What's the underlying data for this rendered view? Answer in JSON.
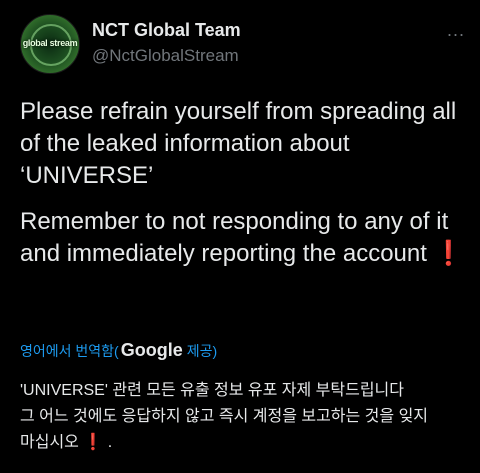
{
  "header": {
    "avatar_text": "global stream",
    "name": "NCT Global Team",
    "handle": "@NctGlobalStream",
    "more_icon": "..."
  },
  "tweet": {
    "paragraph1": "Please refrain yourself from spreading all of the leaked information about ‘UNIVERSE’",
    "paragraph2": "Remember to not responding to any of it and immediately reporting the account",
    "exclamation": "❗"
  },
  "translation": {
    "label_prefix": "영어에서 번역함(",
    "google": "Google",
    "label_suffix": "제공)",
    "line1": "'UNIVERSE' 관련 모든 유출 정보 유포 자제 부탁드립니다",
    "line2": "그 어느 것에도 응답하지 않고 즉시 계정을 보고하는 것을 잊지",
    "line3_text": "마십시오",
    "line3_mark": "❗",
    "line3_end": "."
  },
  "colors": {
    "background": "#000000",
    "text": "#e7e9ea",
    "muted": "#71767b",
    "link": "#1d9bf0",
    "alert": "#e0245e"
  }
}
